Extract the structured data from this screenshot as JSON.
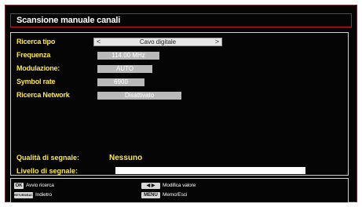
{
  "window": {
    "title": "Scansione manuale canali"
  },
  "settings": [
    {
      "label": "Ricerca tipo",
      "value": "Cavo digitale",
      "selected": true
    },
    {
      "label": "Frequenza",
      "value": "114.00 MHz"
    },
    {
      "label": "Modulazione:",
      "value": "AUTO"
    },
    {
      "label": "Symbol rate",
      "value": "6900"
    },
    {
      "label": "Ricerca Network",
      "value": "Disattivato"
    }
  ],
  "signal": {
    "quality_label": "Qualità di segnale:",
    "quality_value": "Nessuno",
    "level_label": "Livello di segnale:",
    "level": 0
  },
  "footer": {
    "ok_key": "OK",
    "ok_text": "Avvio ricerca",
    "back_key": "RETURN/BACK",
    "back_text": "Indietro",
    "arrows_key": "◀ ▶",
    "arrows_text": "Modifica valore",
    "menu_key": "MENU",
    "menu_text": "Memo/Esci"
  },
  "colors": {
    "accent": "#c8142a",
    "label": "#ffe94a",
    "background": "#050505"
  }
}
